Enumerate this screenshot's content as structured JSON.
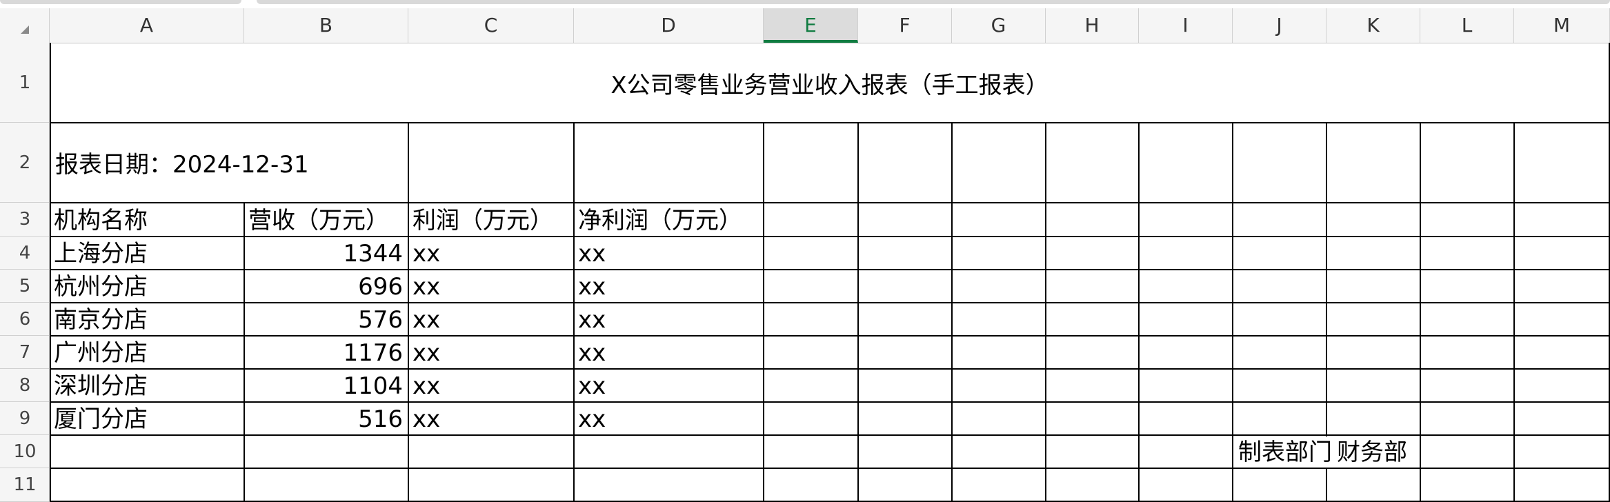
{
  "columns": [
    "A",
    "B",
    "C",
    "D",
    "E",
    "F",
    "G",
    "H",
    "I",
    "J",
    "K",
    "L",
    "M"
  ],
  "selected_column": "E",
  "rows": [
    "1",
    "2",
    "3",
    "4",
    "5",
    "6",
    "7",
    "8",
    "9",
    "10",
    "11"
  ],
  "sheet": {
    "title": "X公司零售业务营业收入报表（手工报表）",
    "report_date": "报表日期：2024-12-31",
    "headers": [
      "机构名称",
      "营收（万元）",
      "利润（万元）",
      "净利润（万元）"
    ],
    "records": [
      {
        "branch": "上海分店",
        "revenue": "1344",
        "profit": "xx",
        "net": "xx"
      },
      {
        "branch": "杭州分店",
        "revenue": "696",
        "profit": "xx",
        "net": "xx"
      },
      {
        "branch": "南京分店",
        "revenue": "576",
        "profit": "xx",
        "net": "xx"
      },
      {
        "branch": "广州分店",
        "revenue": "1176",
        "profit": "xx",
        "net": "xx"
      },
      {
        "branch": "深圳分店",
        "revenue": "1104",
        "profit": "xx",
        "net": "xx"
      },
      {
        "branch": "厦门分店",
        "revenue": "516",
        "profit": "xx",
        "net": "xx"
      }
    ],
    "footer_label": "制表部门",
    "footer_value": "财务部"
  },
  "colors": {
    "accent": "#107c41",
    "grid": "#000000",
    "header_bg": "#f5f5f5"
  }
}
